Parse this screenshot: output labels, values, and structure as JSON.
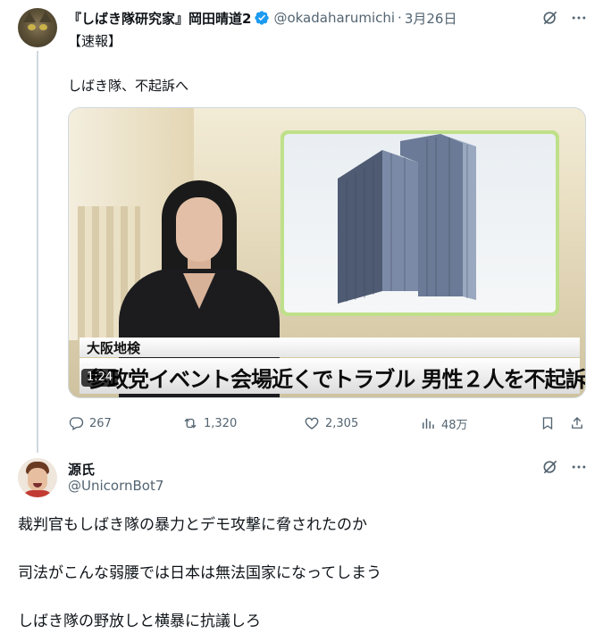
{
  "tweet": {
    "display_name": "『しばき隊研究家』岡田晴道2",
    "handle": "@okadaharumichi",
    "separator": "·",
    "date": "3月26日",
    "text_line1": "【速報】",
    "text_line2": "しばき隊、不起訴へ",
    "media": {
      "caption_top": "大阪地検",
      "caption_main": "参政党イベント会場近くでトラブル 男性２人を不起訴",
      "duration": "1:24"
    },
    "stats": {
      "replies": "267",
      "reposts": "1,320",
      "likes": "2,305",
      "views": "48万"
    }
  },
  "reply": {
    "display_name": "源氏",
    "handle": "@UnicornBot7",
    "line1": "裁判官もしばき隊の暴力とデモ攻撃に脅されたのか",
    "line2": "司法がこんな弱腰では日本は無法国家になってしまう",
    "line3": "しばき隊の野放しと横暴に抗議しろ"
  },
  "colors": {
    "text": "#0f1419",
    "secondary": "#536471",
    "verified": "#1d9bf0",
    "divider": "#cfd9de"
  }
}
